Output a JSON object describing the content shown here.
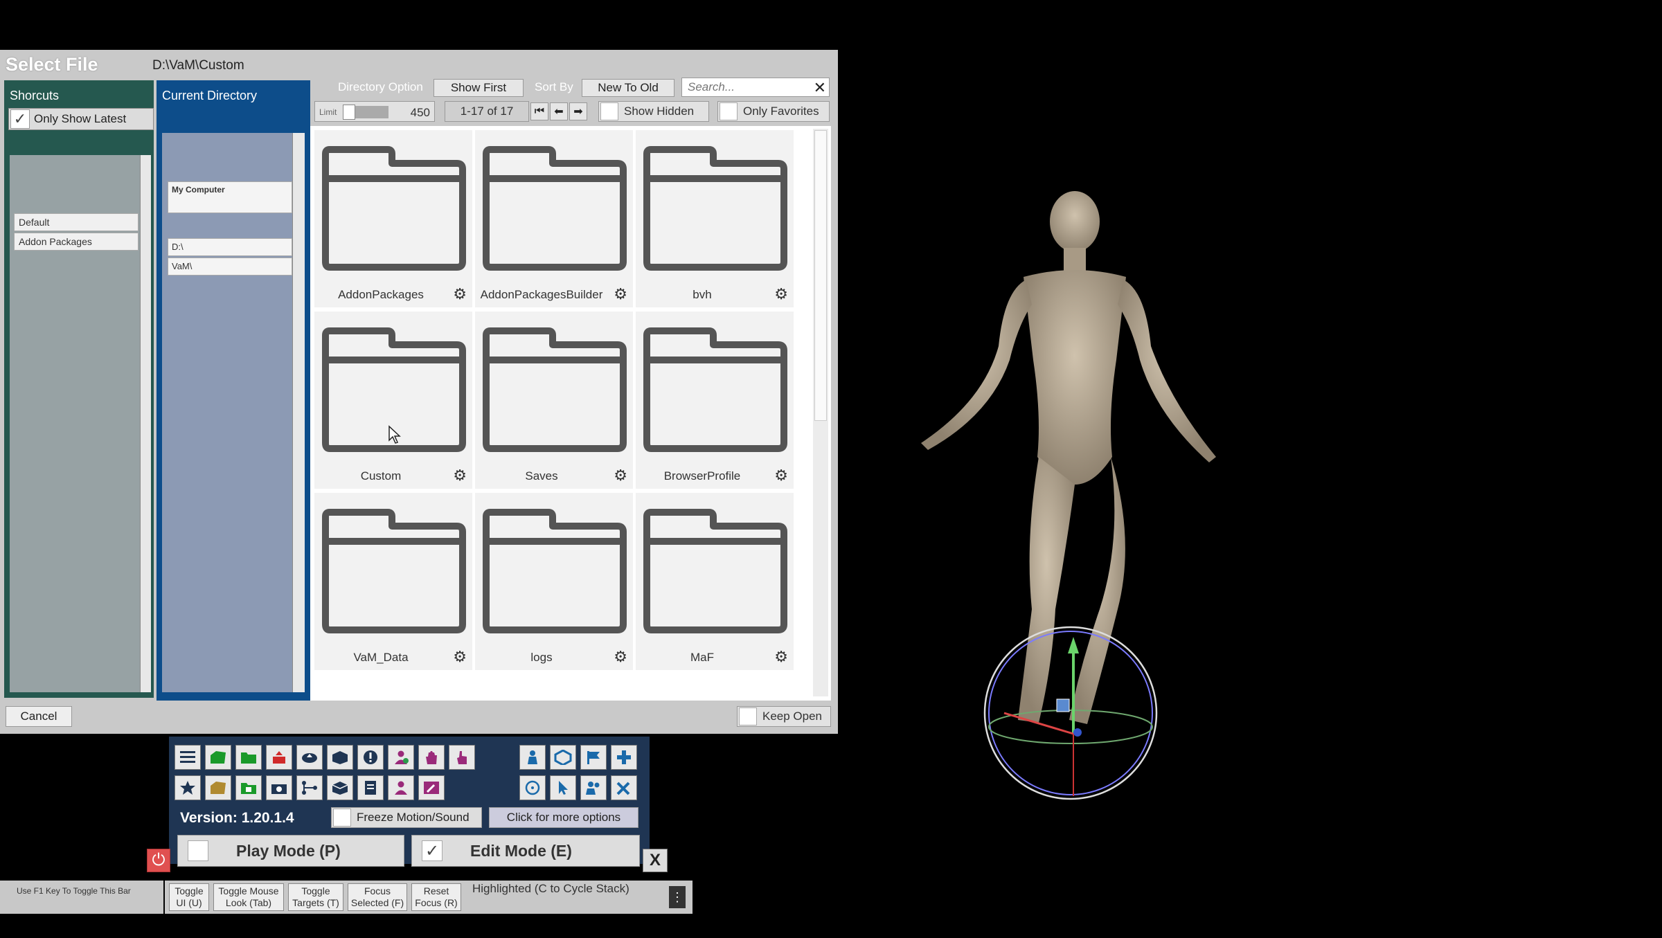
{
  "dialog": {
    "title": "Select File",
    "path": "D:\\VaM\\Custom",
    "cancel_label": "Cancel",
    "keep_open_label": "Keep Open"
  },
  "shortcuts": {
    "heading": "Shorcuts",
    "only_show_latest_label": "Only Show Latest",
    "only_show_latest_checked": true,
    "items": [
      "Default",
      "Addon Packages"
    ]
  },
  "current_directory": {
    "heading": "Current Directory",
    "items": [
      "My Computer",
      "D:\\",
      "VaM\\"
    ]
  },
  "toolbar": {
    "directory_option_label": "Directory Option",
    "show_first_label": "Show First",
    "sort_by_label": "Sort By",
    "sort_value": "New To Old",
    "search_placeholder": "Search...",
    "limit_label": "Limit",
    "limit_value": "450",
    "page_range": "1-17 of 17",
    "show_hidden_label": "Show Hidden",
    "only_favorites_label": "Only Favorites"
  },
  "files": [
    "AddonPackages",
    "AddonPackagesBuilder",
    "bvh",
    "Custom",
    "Saves",
    "BrowserProfile",
    "VaM_Data",
    "logs",
    "MaF"
  ],
  "control_panel": {
    "version": "Version: 1.20.1.4",
    "freeze_label": "Freeze Motion/Sound",
    "more_options_label": "Click for more options",
    "play_mode_label": "Play Mode (P)",
    "edit_mode_label": "Edit Mode (E)",
    "edit_mode_checked": true,
    "close_label": "X",
    "colors": {
      "accent_blue": "#0d4d8a",
      "panel_green": "#25584f",
      "panel_bg": "#1f3553",
      "power_red": "#e05050"
    }
  },
  "hotkey_bar": {
    "hint": "Use F1 Key To Toggle This Bar",
    "buttons": [
      {
        "line1": "Toggle",
        "line2": "UI (U)"
      },
      {
        "line1": "Toggle Mouse",
        "line2": "Look (Tab)"
      },
      {
        "line1": "Toggle",
        "line2": "Targets (T)"
      },
      {
        "line1": "Focus",
        "line2": "Selected (F)"
      },
      {
        "line1": "Reset",
        "line2": "Focus (R)"
      }
    ],
    "highlighted": "Highlighted (C to Cycle Stack)"
  }
}
